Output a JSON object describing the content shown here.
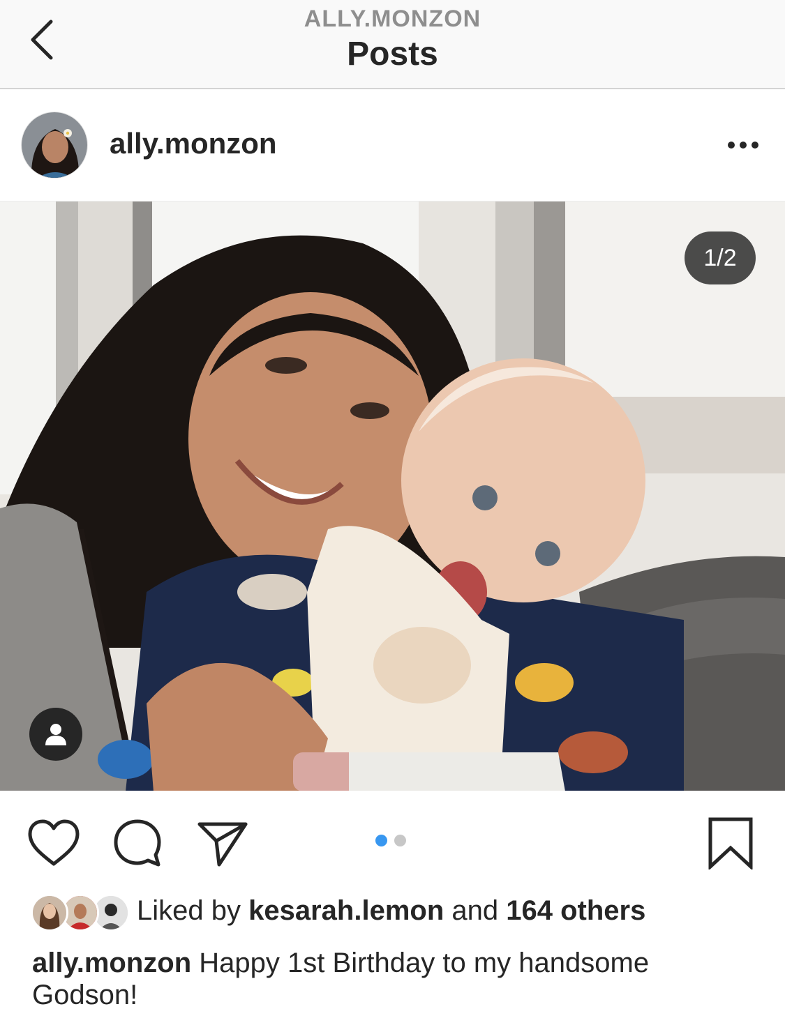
{
  "nav": {
    "subtitle": "ALLY.MONZON",
    "title": "Posts"
  },
  "post": {
    "username": "ally.monzon",
    "image_counter": "1/2",
    "carousel": {
      "total": 2,
      "active": 1
    },
    "likes": {
      "prefix": "Liked by",
      "top_liker": "kesarah.lemon",
      "connector": "and",
      "others": "164 others"
    },
    "caption": {
      "author": "ally.monzon",
      "text": "Happy 1st Birthday to my handsome Godson!"
    }
  },
  "icons": {
    "back": "chevron-left-icon",
    "more": "more-horizontal-icon",
    "tag": "person-tag-icon",
    "like": "heart-icon",
    "comment": "comment-bubble-icon",
    "share": "paper-plane-icon",
    "save": "bookmark-icon"
  },
  "colors": {
    "active_dot": "#3897f0",
    "inactive_dot": "#c7c7c7",
    "text": "#262626",
    "muted": "#8e8e8e"
  }
}
